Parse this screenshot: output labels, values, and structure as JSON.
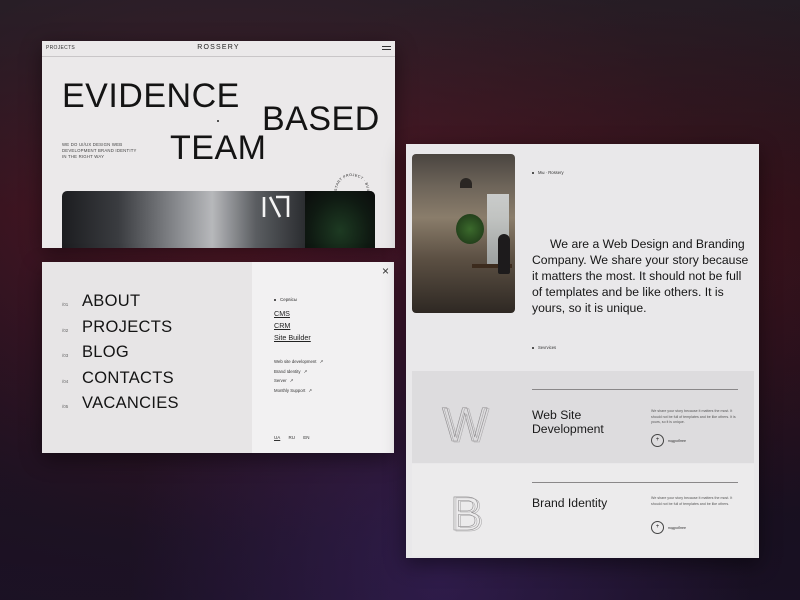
{
  "hero": {
    "nav_left": "PROJECTS",
    "brand": "ROSSERY",
    "headline_1": "EVIDENCE",
    "headline_2": "BASED",
    "headline_3": "TEAM",
    "subtitle": "WE DO UI/UX DESIGN WEB DEVELOPMENT BRAND IDENTITY IN THE RIGHT WAY",
    "badge_text": "START PROJECT · BUILD THE BRAND · "
  },
  "menu": {
    "close_symbol": "×",
    "items": [
      {
        "num": "/01",
        "label": "ABOUT"
      },
      {
        "num": "/02",
        "label": "PROJECTS"
      },
      {
        "num": "/03",
        "label": "BLOG"
      },
      {
        "num": "/04",
        "label": "CONTACTS"
      },
      {
        "num": "/05",
        "label": "VACANCIES"
      }
    ],
    "services_title": "Сервісы",
    "service_links": [
      "CMS",
      "CRM",
      "Site Builder"
    ],
    "sub_links": [
      {
        "label": "Web site development",
        "arrow": "↗"
      },
      {
        "label": "Brand Identity",
        "arrow": "↗"
      },
      {
        "label": "Server",
        "arrow": "↗"
      },
      {
        "label": "Monthly Support",
        "arrow": "↗"
      }
    ],
    "langs": [
      "UA",
      "RU",
      "EN"
    ]
  },
  "about": {
    "breadcrumb": "Мы · Rossery",
    "text": "We are a Web Design and Branding Company. We share your story because it matters the most. It should not be full of templates and be like others. It is yours, so it is unique.",
    "services_label": "Sevrvices",
    "services": [
      {
        "monogram": "W",
        "name": "Web Site Development",
        "desc": "We share your story because it matters the most. It should not be full of templates and be like others. It is yours, so it is unique.",
        "more_symbol": "+",
        "more_label": "подробнее"
      },
      {
        "monogram": "B",
        "name": "Brand Identity",
        "desc": "We share your story because it matters the most. It should not be full of templates and be like others.",
        "more_symbol": "+",
        "more_label": "подробнее"
      }
    ]
  }
}
